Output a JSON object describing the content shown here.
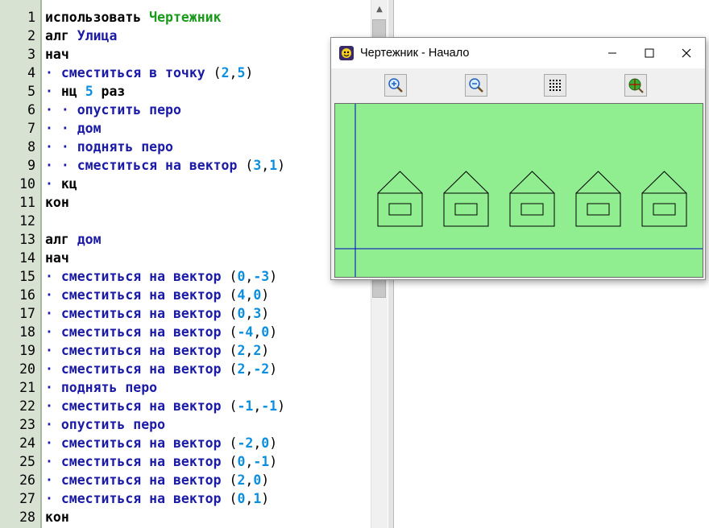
{
  "editor": {
    "lines": [
      {
        "n": "1",
        "tokens": [
          {
            "t": "использовать ",
            "c": "kw"
          },
          {
            "t": "Чертежник",
            "c": "lib"
          }
        ]
      },
      {
        "n": "2",
        "tokens": [
          {
            "t": "алг ",
            "c": "kw"
          },
          {
            "t": "Улица",
            "c": "fn"
          }
        ]
      },
      {
        "n": "3",
        "tokens": [
          {
            "t": "нач",
            "c": "kw"
          }
        ]
      },
      {
        "n": "4",
        "tokens": [
          {
            "t": "· ",
            "c": "dot"
          },
          {
            "t": "сместиться в точку ",
            "c": "fn"
          },
          {
            "t": "(",
            "c": "p"
          },
          {
            "t": "2",
            "c": "num"
          },
          {
            "t": ",",
            "c": "p"
          },
          {
            "t": "5",
            "c": "num"
          },
          {
            "t": ")",
            "c": "p"
          }
        ]
      },
      {
        "n": "5",
        "tokens": [
          {
            "t": "· ",
            "c": "dot"
          },
          {
            "t": "нц ",
            "c": "kw"
          },
          {
            "t": "5",
            "c": "num"
          },
          {
            "t": " раз",
            "c": "kw"
          }
        ]
      },
      {
        "n": "6",
        "tokens": [
          {
            "t": "· · ",
            "c": "dot"
          },
          {
            "t": "опустить перо",
            "c": "fn"
          }
        ]
      },
      {
        "n": "7",
        "tokens": [
          {
            "t": "· · ",
            "c": "dot"
          },
          {
            "t": "дом",
            "c": "fn"
          }
        ]
      },
      {
        "n": "8",
        "tokens": [
          {
            "t": "· · ",
            "c": "dot"
          },
          {
            "t": "поднять перо",
            "c": "fn"
          }
        ]
      },
      {
        "n": "9",
        "tokens": [
          {
            "t": "· · ",
            "c": "dot"
          },
          {
            "t": "сместиться на вектор ",
            "c": "fn"
          },
          {
            "t": "(",
            "c": "p"
          },
          {
            "t": "3",
            "c": "num"
          },
          {
            "t": ",",
            "c": "p"
          },
          {
            "t": "1",
            "c": "num"
          },
          {
            "t": ")",
            "c": "p"
          }
        ]
      },
      {
        "n": "10",
        "tokens": [
          {
            "t": "· ",
            "c": "dot"
          },
          {
            "t": "кц",
            "c": "kw"
          }
        ]
      },
      {
        "n": "11",
        "tokens": [
          {
            "t": "кон",
            "c": "kw"
          }
        ]
      },
      {
        "n": "12",
        "tokens": []
      },
      {
        "n": "13",
        "tokens": [
          {
            "t": "алг ",
            "c": "kw"
          },
          {
            "t": "дом",
            "c": "fn"
          }
        ]
      },
      {
        "n": "14",
        "tokens": [
          {
            "t": "нач",
            "c": "kw"
          }
        ]
      },
      {
        "n": "15",
        "tokens": [
          {
            "t": "· ",
            "c": "dot"
          },
          {
            "t": "сместиться на вектор ",
            "c": "fn"
          },
          {
            "t": "(",
            "c": "p"
          },
          {
            "t": "0",
            "c": "num"
          },
          {
            "t": ",",
            "c": "p"
          },
          {
            "t": "-3",
            "c": "num"
          },
          {
            "t": ")",
            "c": "p"
          }
        ]
      },
      {
        "n": "16",
        "tokens": [
          {
            "t": "· ",
            "c": "dot"
          },
          {
            "t": "сместиться на вектор ",
            "c": "fn"
          },
          {
            "t": "(",
            "c": "p"
          },
          {
            "t": "4",
            "c": "num"
          },
          {
            "t": ",",
            "c": "p"
          },
          {
            "t": "0",
            "c": "num"
          },
          {
            "t": ")",
            "c": "p"
          }
        ]
      },
      {
        "n": "17",
        "tokens": [
          {
            "t": "· ",
            "c": "dot"
          },
          {
            "t": "сместиться на вектор ",
            "c": "fn"
          },
          {
            "t": "(",
            "c": "p"
          },
          {
            "t": "0",
            "c": "num"
          },
          {
            "t": ",",
            "c": "p"
          },
          {
            "t": "3",
            "c": "num"
          },
          {
            "t": ")",
            "c": "p"
          }
        ]
      },
      {
        "n": "18",
        "tokens": [
          {
            "t": "· ",
            "c": "dot"
          },
          {
            "t": "сместиться на вектор ",
            "c": "fn"
          },
          {
            "t": "(",
            "c": "p"
          },
          {
            "t": "-4",
            "c": "num"
          },
          {
            "t": ",",
            "c": "p"
          },
          {
            "t": "0",
            "c": "num"
          },
          {
            "t": ")",
            "c": "p"
          }
        ]
      },
      {
        "n": "19",
        "tokens": [
          {
            "t": "· ",
            "c": "dot"
          },
          {
            "t": "сместиться на вектор ",
            "c": "fn"
          },
          {
            "t": "(",
            "c": "p"
          },
          {
            "t": "2",
            "c": "num"
          },
          {
            "t": ",",
            "c": "p"
          },
          {
            "t": "2",
            "c": "num"
          },
          {
            "t": ")",
            "c": "p"
          }
        ]
      },
      {
        "n": "20",
        "tokens": [
          {
            "t": "· ",
            "c": "dot"
          },
          {
            "t": "сместиться на вектор ",
            "c": "fn"
          },
          {
            "t": "(",
            "c": "p"
          },
          {
            "t": "2",
            "c": "num"
          },
          {
            "t": ",",
            "c": "p"
          },
          {
            "t": "-2",
            "c": "num"
          },
          {
            "t": ")",
            "c": "p"
          }
        ]
      },
      {
        "n": "21",
        "tokens": [
          {
            "t": "· ",
            "c": "dot"
          },
          {
            "t": "поднять перо",
            "c": "fn"
          }
        ]
      },
      {
        "n": "22",
        "tokens": [
          {
            "t": "· ",
            "c": "dot"
          },
          {
            "t": "сместиться на вектор ",
            "c": "fn"
          },
          {
            "t": "(",
            "c": "p"
          },
          {
            "t": "-1",
            "c": "num"
          },
          {
            "t": ",",
            "c": "p"
          },
          {
            "t": "-1",
            "c": "num"
          },
          {
            "t": ")",
            "c": "p"
          }
        ]
      },
      {
        "n": "23",
        "tokens": [
          {
            "t": "· ",
            "c": "dot"
          },
          {
            "t": "опустить перо",
            "c": "fn"
          }
        ]
      },
      {
        "n": "24",
        "tokens": [
          {
            "t": "· ",
            "c": "dot"
          },
          {
            "t": "сместиться на вектор ",
            "c": "fn"
          },
          {
            "t": "(",
            "c": "p"
          },
          {
            "t": "-2",
            "c": "num"
          },
          {
            "t": ",",
            "c": "p"
          },
          {
            "t": "0",
            "c": "num"
          },
          {
            "t": ")",
            "c": "p"
          }
        ]
      },
      {
        "n": "25",
        "tokens": [
          {
            "t": "· ",
            "c": "dot"
          },
          {
            "t": "сместиться на вектор ",
            "c": "fn"
          },
          {
            "t": "(",
            "c": "p"
          },
          {
            "t": "0",
            "c": "num"
          },
          {
            "t": ",",
            "c": "p"
          },
          {
            "t": "-1",
            "c": "num"
          },
          {
            "t": ")",
            "c": "p"
          }
        ]
      },
      {
        "n": "26",
        "tokens": [
          {
            "t": "· ",
            "c": "dot"
          },
          {
            "t": "сместиться на вектор ",
            "c": "fn"
          },
          {
            "t": "(",
            "c": "p"
          },
          {
            "t": "2",
            "c": "num"
          },
          {
            "t": ",",
            "c": "p"
          },
          {
            "t": "0",
            "c": "num"
          },
          {
            "t": ")",
            "c": "p"
          }
        ]
      },
      {
        "n": "27",
        "tokens": [
          {
            "t": "· ",
            "c": "dot"
          },
          {
            "t": "сместиться на вектор ",
            "c": "fn"
          },
          {
            "t": "(",
            "c": "p"
          },
          {
            "t": "0",
            "c": "num"
          },
          {
            "t": ",",
            "c": "p"
          },
          {
            "t": "1",
            "c": "num"
          },
          {
            "t": ")",
            "c": "p"
          }
        ]
      },
      {
        "n": "28",
        "tokens": [
          {
            "t": "кон",
            "c": "kw"
          }
        ]
      }
    ]
  },
  "drawer_window": {
    "title": "Чертежник - Начало",
    "icon": "smiley-face-icon",
    "controls": [
      "minimize-icon",
      "maximize-icon",
      "close-icon"
    ],
    "toolbar": [
      "zoom-in-icon",
      "zoom-out-icon",
      "grid-icon",
      "fit-view-icon"
    ],
    "canvas_background": "#90ee90",
    "axis_color": "#0000cc",
    "house_count": 5
  },
  "colors": {
    "keyword": "#000000",
    "identifier": "#1a1aa6",
    "number": "#0a8ee0",
    "library": "#1a9a1a",
    "gutter": "#d8e2d2"
  }
}
